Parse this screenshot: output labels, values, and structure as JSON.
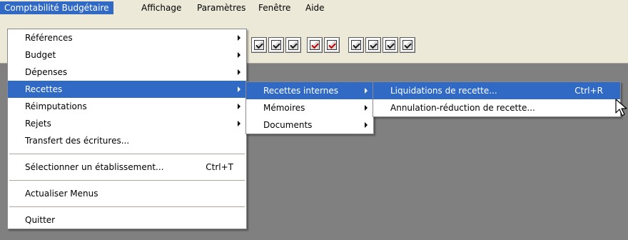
{
  "menubar": {
    "items": [
      {
        "label": "Comptabilité Budgétaire"
      },
      {
        "label": "Affichage"
      },
      {
        "label": "Paramètres"
      },
      {
        "label": "Fenêtre"
      },
      {
        "label": "Aide"
      }
    ]
  },
  "main_menu": {
    "items": [
      {
        "label": "Références"
      },
      {
        "label": "Budget"
      },
      {
        "label": "Dépenses"
      },
      {
        "label": "Recettes"
      },
      {
        "label": "Réimputations"
      },
      {
        "label": "Rejets"
      },
      {
        "label": "Transfert des écritures..."
      },
      {
        "label": "Sélectionner un établissement...",
        "shortcut": "Ctrl+T"
      },
      {
        "label": "Actualiser Menus"
      },
      {
        "label": "Quitter"
      }
    ]
  },
  "recettes_menu": {
    "items": [
      {
        "label": "Recettes internes"
      },
      {
        "label": "Mémoires"
      },
      {
        "label": "Documents"
      }
    ]
  },
  "internes_menu": {
    "items": [
      {
        "label": "Liquidations de recette...",
        "shortcut": "Ctrl+R"
      },
      {
        "label": "Annulation-réduction de recette..."
      }
    ]
  },
  "colors": {
    "highlight": "#316ac5",
    "desktop": "#808080",
    "chrome": "#ece9d8"
  }
}
